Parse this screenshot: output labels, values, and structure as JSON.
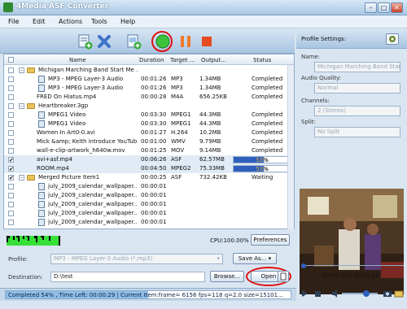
{
  "window": {
    "title": "4Media ASF Converter",
    "minimize": "–",
    "maximize": "□",
    "close": "✕"
  },
  "menu": [
    "File",
    "Edit",
    "Actions",
    "Tools",
    "Help"
  ],
  "toolbar": {
    "icons": [
      "add-file-icon",
      "delete-icon",
      "add-folder-icon",
      "start-icon",
      "pause-icon",
      "stop-icon"
    ]
  },
  "table": {
    "headers": [
      "Name",
      "Duration",
      "Target ...",
      "Output...",
      "Status"
    ],
    "rows": [
      {
        "type": "group",
        "checked": false,
        "name": "Michigan Marching Band  Start Me ...",
        "duration": "",
        "target": "",
        "output": "",
        "status": ""
      },
      {
        "type": "child",
        "checked": false,
        "name": "MP3 - MPEG Layer-3 Audio",
        "duration": "00:01:26",
        "target": "MP3",
        "output": "1.34MB",
        "status": "Completed"
      },
      {
        "type": "child",
        "checked": false,
        "name": "MP3 - MPEG Layer-3 Audio",
        "duration": "00:01:26",
        "target": "MP3",
        "output": "1.34MB",
        "status": "Completed"
      },
      {
        "type": "file",
        "checked": false,
        "name": "FRED On Hiatus.mp4",
        "duration": "00:00:28",
        "target": "M4A",
        "output": "656.25KB",
        "status": "Completed"
      },
      {
        "type": "group",
        "checked": false,
        "name": "Heartbreaker.3gp",
        "duration": "",
        "target": "",
        "output": "",
        "status": ""
      },
      {
        "type": "child",
        "checked": false,
        "name": "MPEG1 Video",
        "duration": "00:03:30",
        "target": "MPEG1",
        "output": "44.3MB",
        "status": "Completed"
      },
      {
        "type": "child",
        "checked": false,
        "name": "MPEG1 Video",
        "duration": "00:03:30",
        "target": "MPEG1",
        "output": "44.3MB",
        "status": "Completed"
      },
      {
        "type": "file",
        "checked": false,
        "name": "Women In Art0-0.avi",
        "duration": "00:01:27",
        "target": "H.264",
        "output": "10.2MB",
        "status": "Completed"
      },
      {
        "type": "file",
        "checked": false,
        "name": "Mick &amp; Keith introduce YouTub...",
        "duration": "00:01:00",
        "target": "WMV",
        "output": "9.79MB",
        "status": "Completed"
      },
      {
        "type": "file",
        "checked": false,
        "name": "wall-e-clip-artwork_h640w.mov",
        "duration": "00:01:25",
        "target": "MOV",
        "output": "9.14MB",
        "status": "Completed"
      },
      {
        "type": "file",
        "checked": true,
        "name": "avi+asf.mp4",
        "duration": "00:06:26",
        "target": "ASF",
        "output": "62.57MB",
        "status": "53%",
        "progress": 0.53
      },
      {
        "type": "file",
        "checked": true,
        "name": "ROOM.mp4",
        "duration": "00:04:50",
        "target": "MPEG2",
        "output": "75.33MB",
        "status": "53%",
        "progress": 0.53
      },
      {
        "type": "group",
        "checked": true,
        "name": "Merged Picture Item1",
        "duration": "00:00:25",
        "target": "ASF",
        "output": "732.42KB",
        "status": "Waiting"
      },
      {
        "type": "child",
        "checked": false,
        "name": "july_2009_calendar_wallpaper...",
        "duration": "00:00:01",
        "target": "",
        "output": "",
        "status": ""
      },
      {
        "type": "child",
        "checked": false,
        "name": "july_2009_calendar_wallpaper...",
        "duration": "00:00:01",
        "target": "",
        "output": "",
        "status": ""
      },
      {
        "type": "child",
        "checked": false,
        "name": "july_2009_calendar_wallpaper...",
        "duration": "00:00:01",
        "target": "",
        "output": "",
        "status": ""
      },
      {
        "type": "child",
        "checked": false,
        "name": "july_2009_calendar_wallpaper...",
        "duration": "00:00:01",
        "target": "",
        "output": "",
        "status": ""
      },
      {
        "type": "child",
        "checked": false,
        "name": "july_2009_calendar_wallpaper...",
        "duration": "00:00:01",
        "target": "",
        "output": "",
        "status": ""
      }
    ]
  },
  "cpu": {
    "label": "CPU:100.00%",
    "preferences": "Preferences"
  },
  "profile": {
    "label": "Profile:",
    "value": "MP3 - MPEG Layer-3 Audio (*.mp3)",
    "save_as": "Save As...",
    "dropdown": "▾"
  },
  "destination": {
    "label": "Destination:",
    "value": "D:\\test",
    "browse": "Browse...",
    "open": "Open"
  },
  "status": {
    "text": "Completed 54% , Time Left: 00:00:29  | Current Item:frame= 6156 fps=118 q=2.0 size=15101..."
  },
  "profile_settings": {
    "title": "Profile Settings:",
    "name_label": "Name:",
    "name_value": "Michigan Marching Band  Start",
    "audio_quality_label": "Audio Quality:",
    "audio_quality_value": "Normal",
    "channels_label": "Channels:",
    "channels_value": "2 (Stereo)",
    "split_label": "Split:",
    "split_value": "No Split"
  },
  "player": {
    "time": "00:00:00 / 00:01:26"
  },
  "colors": {
    "accent": "#2f5fbd",
    "highlight_circle": "#e01010"
  }
}
